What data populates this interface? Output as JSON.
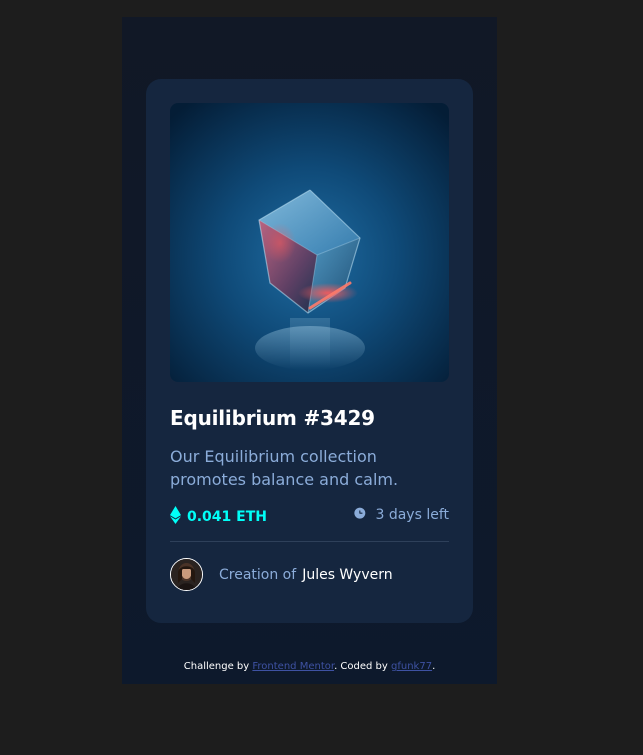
{
  "card": {
    "image_alt": "equilibrium",
    "title": "Equilibrium #3429",
    "description": "Our Equilibrium collection promotes balance and calm.",
    "price": "0.041 ETH",
    "time_left": "3 days left",
    "creator_prefix": "Creation of",
    "creator_name": "Jules Wyvern"
  },
  "footer": {
    "challenge_prefix": "Challenge by",
    "challenge_link": "Frontend Mentor",
    "coded_prefix": ". Coded by",
    "coded_link": "gfunk77",
    "suffix": "."
  },
  "colors": {
    "page_background": "#1d1d1d",
    "main_background": "#0d192c",
    "card_background": "#15263f",
    "cyan": "#00fff8",
    "soft_blue": "#8bacd9",
    "white": "#ffffff",
    "link": "#3e52a3"
  },
  "icons": {
    "ethereum": "ethereum-icon",
    "clock": "clock-icon"
  }
}
